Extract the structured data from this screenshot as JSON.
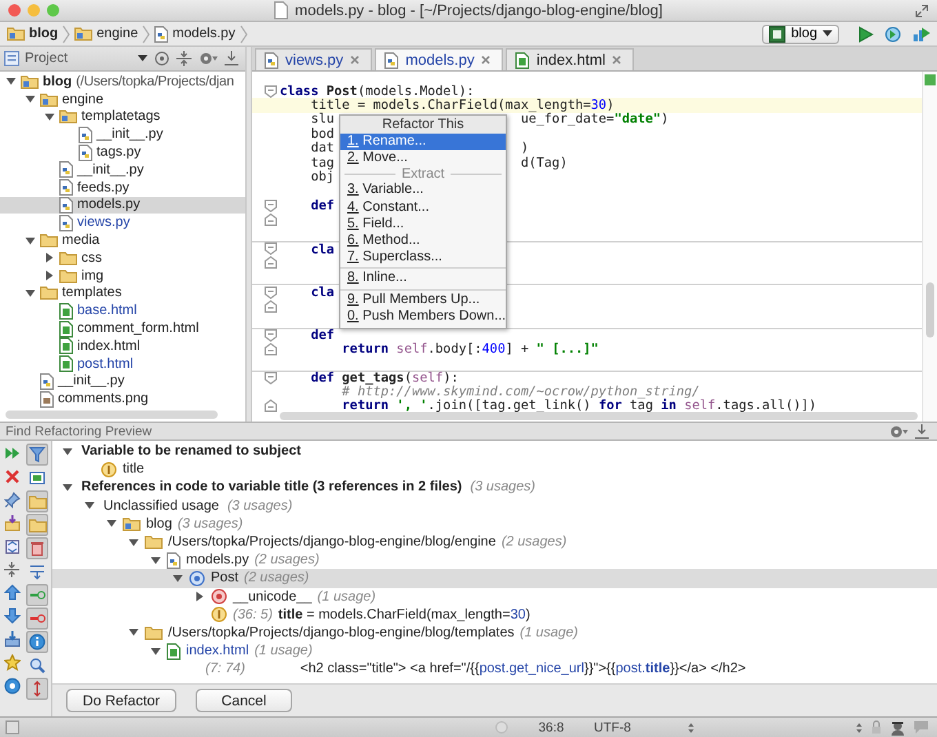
{
  "window": {
    "title": "models.py - blog - [~/Projects/django-blog-engine/blog]"
  },
  "breadcrumbs": [
    {
      "label": "blog",
      "kind": "module",
      "bold": true
    },
    {
      "label": "engine",
      "kind": "module",
      "bold": false
    },
    {
      "label": "models.py",
      "kind": "py",
      "bold": false
    }
  ],
  "run_config": {
    "label": "blog"
  },
  "project": {
    "title": "Project",
    "tree": [
      {
        "label": "blog",
        "path": "(/Users/topka/Projects/djan",
        "kind": "module",
        "expanded": true,
        "selected": false,
        "children": [
          {
            "label": "engine",
            "kind": "module",
            "expanded": true,
            "selected": false,
            "children": [
              {
                "label": "templatetags",
                "kind": "module",
                "expanded": true,
                "selected": false,
                "children": [
                  {
                    "label": "__init__.py",
                    "kind": "py",
                    "selected": false
                  },
                  {
                    "label": "tags.py",
                    "kind": "py",
                    "selected": false
                  }
                ]
              },
              {
                "label": "__init__.py",
                "kind": "py",
                "selected": false
              },
              {
                "label": "feeds.py",
                "kind": "py",
                "selected": false
              },
              {
                "label": "models.py",
                "kind": "py",
                "selected": true
              },
              {
                "label": "views.py",
                "kind": "py",
                "selected": false,
                "color": "#2545a8"
              }
            ]
          },
          {
            "label": "media",
            "kind": "folder",
            "expanded": true,
            "selected": false,
            "children": [
              {
                "label": "css",
                "kind": "folder",
                "expanded": false,
                "selected": false
              },
              {
                "label": "img",
                "kind": "folder",
                "expanded": false,
                "selected": false
              }
            ]
          },
          {
            "label": "templates",
            "kind": "folder",
            "expanded": true,
            "selected": false,
            "children": [
              {
                "label": "base.html",
                "kind": "html",
                "selected": false,
                "color": "#2545a8"
              },
              {
                "label": "comment_form.html",
                "kind": "html",
                "selected": false
              },
              {
                "label": "index.html",
                "kind": "html",
                "selected": false
              },
              {
                "label": "post.html",
                "kind": "html",
                "selected": false,
                "color": "#2545a8"
              }
            ]
          },
          {
            "label": "__init__.py",
            "kind": "py",
            "selected": false
          },
          {
            "label": "comments.png",
            "kind": "png",
            "selected": false
          }
        ]
      }
    ]
  },
  "tabs": [
    {
      "label": "views.py",
      "kind": "py",
      "selected": false,
      "color": "#2545a8"
    },
    {
      "label": "models.py",
      "kind": "py",
      "selected": true,
      "color": "#2545a8"
    },
    {
      "label": "index.html",
      "kind": "html",
      "selected": false,
      "color": "#222222"
    }
  ],
  "editor": {
    "lines": [
      {
        "kind": "code",
        "fold_start": true,
        "segs": [
          {
            "text": "class",
            "kind": "kw"
          },
          {
            "text": " Post",
            "kind": "name"
          },
          {
            "text": "(models.Model):",
            "kind": "plain"
          }
        ]
      },
      {
        "kind": "code",
        "current": true,
        "segs": [
          {
            "text": "    title = models.CharField(max_length=",
            "kind": "plain"
          },
          {
            "text": "30",
            "kind": "num"
          },
          {
            "text": ")",
            "kind": "plain"
          }
        ]
      },
      {
        "kind": "code",
        "segs": [
          {
            "text": "    slu",
            "kind": "plain"
          }
        ],
        "tail": [
          {
            "text": "ue_for_date=",
            "kind": "plain"
          },
          {
            "text": "\"date\"",
            "kind": "str"
          },
          {
            "text": ")",
            "kind": "plain"
          }
        ]
      },
      {
        "kind": "code",
        "segs": [
          {
            "text": "    bod",
            "kind": "plain"
          }
        ]
      },
      {
        "kind": "code",
        "segs": [
          {
            "text": "    dat",
            "kind": "plain"
          }
        ],
        "tail": [
          {
            "text": ")",
            "kind": "plain"
          }
        ]
      },
      {
        "kind": "code",
        "segs": [
          {
            "text": "    tag",
            "kind": "plain"
          }
        ],
        "tail": [
          {
            "text": "d(Tag)",
            "kind": "plain"
          }
        ]
      },
      {
        "kind": "code",
        "segs": [
          {
            "text": "    obj",
            "kind": "plain"
          }
        ]
      },
      {
        "kind": "blank"
      },
      {
        "kind": "code",
        "fold_start": true,
        "segs": [
          {
            "text": "    def",
            "kind": "kw"
          }
        ]
      },
      {
        "kind": "blank",
        "fold_end": true
      },
      {
        "kind": "blank"
      },
      {
        "kind": "code",
        "fold_start": true,
        "separator": true,
        "segs": [
          {
            "text": "    cla",
            "kind": "kw"
          }
        ]
      },
      {
        "kind": "blank",
        "fold_end": true
      },
      {
        "kind": "blank"
      },
      {
        "kind": "code",
        "fold_start": true,
        "separator": true,
        "segs": [
          {
            "text": "    cla",
            "kind": "kw"
          }
        ]
      },
      {
        "kind": "blank",
        "fold_end": true
      },
      {
        "kind": "blank"
      },
      {
        "kind": "code",
        "fold_start": true,
        "separator": true,
        "segs": [
          {
            "text": "    def",
            "kind": "kw"
          }
        ]
      },
      {
        "kind": "code",
        "fold_end": true,
        "segs": [
          {
            "text": "        return",
            "kind": "kw"
          },
          {
            "text": " self",
            "kind": "self"
          },
          {
            "text": ".body[:",
            "kind": "plain"
          },
          {
            "text": "400",
            "kind": "num"
          },
          {
            "text": "] + ",
            "kind": "plain"
          },
          {
            "text": "\" [...]\"",
            "kind": "str"
          }
        ]
      },
      {
        "kind": "blank"
      },
      {
        "kind": "code",
        "fold_start": true,
        "separator": true,
        "segs": [
          {
            "text": "    def",
            "kind": "kw"
          },
          {
            "text": " get_tags",
            "kind": "name"
          },
          {
            "text": "(",
            "kind": "plain"
          },
          {
            "text": "self",
            "kind": "self"
          },
          {
            "text": "):",
            "kind": "plain"
          }
        ]
      },
      {
        "kind": "code",
        "segs": [
          {
            "text": "        # http://www.skymind.com/~ocrow/python_string/",
            "kind": "comment"
          }
        ]
      },
      {
        "kind": "code",
        "fold_end": true,
        "segs": [
          {
            "text": "        return",
            "kind": "kw"
          },
          {
            "text": " ', '",
            "kind": "str"
          },
          {
            "text": ".join([tag.get_link() ",
            "kind": "plain"
          },
          {
            "text": "for",
            "kind": "kw"
          },
          {
            "text": " tag ",
            "kind": "plain"
          },
          {
            "text": "in",
            "kind": "kw"
          },
          {
            "text": " self",
            "kind": "self"
          },
          {
            "text": ".tags.all()])",
            "kind": "plain"
          }
        ]
      }
    ]
  },
  "popup": {
    "title": "Refactor This",
    "items": [
      {
        "kind": "item",
        "label": "1. Rename...",
        "selected": true
      },
      {
        "kind": "item",
        "label": "2. Move...",
        "selected": false
      },
      {
        "kind": "section",
        "label": "Extract"
      },
      {
        "kind": "item",
        "label": "3. Variable...",
        "selected": false
      },
      {
        "kind": "item",
        "label": "4. Constant...",
        "selected": false
      },
      {
        "kind": "item",
        "label": "5. Field...",
        "selected": false
      },
      {
        "kind": "item",
        "label": "6. Method...",
        "selected": false
      },
      {
        "kind": "item",
        "label": "7. Superclass...",
        "selected": false
      },
      {
        "kind": "divider"
      },
      {
        "kind": "item",
        "label": "8. Inline...",
        "selected": false
      },
      {
        "kind": "divider"
      },
      {
        "kind": "item",
        "label": "9. Pull Members Up...",
        "selected": false
      },
      {
        "kind": "item",
        "label": "0. Push Members Down...",
        "selected": false
      }
    ]
  },
  "preview": {
    "title": "Find Refactoring Preview",
    "toolbar": [
      {
        "kind": "rerun"
      },
      {
        "kind": "close"
      },
      {
        "kind": "pin"
      },
      {
        "kind": "import"
      },
      {
        "kind": "expand"
      },
      {
        "kind": "collapse"
      },
      {
        "kind": "up"
      },
      {
        "kind": "down"
      },
      {
        "kind": "export"
      },
      {
        "kind": "star"
      },
      {
        "kind": "help"
      }
    ],
    "toggles": [
      {
        "kind": "filter",
        "pressed": true
      },
      {
        "kind": "preview",
        "pressed": false
      },
      {
        "kind": "folder",
        "pressed": true
      },
      {
        "kind": "folder",
        "pressed": true
      },
      {
        "kind": "trash",
        "pressed": true
      },
      {
        "kind": "merge",
        "pressed": false
      },
      {
        "kind": "add",
        "pressed": true
      },
      {
        "kind": "remove",
        "pressed": true
      },
      {
        "kind": "info",
        "pressed": true
      },
      {
        "kind": "search",
        "pressed": false
      },
      {
        "kind": "sort",
        "pressed": true
      }
    ],
    "tree": [
      {
        "kind": "group",
        "label": "Variable to be renamed to subject",
        "bold": true,
        "expanded": true,
        "selected": false,
        "children": [
          {
            "kind": "field",
            "label": "title",
            "selected": false
          }
        ]
      },
      {
        "kind": "group",
        "label": "References in code to variable title (3 references in 2 files)",
        "bold": true,
        "usages": "(3 usages)",
        "expanded": true,
        "selected": false,
        "children": [
          {
            "kind": "group",
            "label": "Unclassified usage",
            "usages": "(3 usages)",
            "expanded": true,
            "selected": false,
            "children": [
              {
                "kind": "module",
                "label": "blog",
                "usages": "(3 usages)",
                "expanded": true,
                "selected": false,
                "children": [
                  {
                    "kind": "folder",
                    "label": "/Users/topka/Projects/django-blog-engine/blog/engine",
                    "usages": "(2 usages)",
                    "expanded": true,
                    "selected": false,
                    "children": [
                      {
                        "kind": "py",
                        "label": "models.py",
                        "usages": "(2 usages)",
                        "expanded": true,
                        "selected": false,
                        "children": [
                          {
                            "kind": "class",
                            "label": "Post",
                            "usages": "(2 usages)",
                            "expanded": true,
                            "selected": true,
                            "children": [
                              {
                                "kind": "method",
                                "label": "__unicode__",
                                "usages": "(1 usage)",
                                "expanded": false,
                                "selected": false
                              },
                              {
                                "kind": "field",
                                "location": "(36: 5)",
                                "selected": false,
                                "code": [
                                  {
                                    "text": "**title** = models.CharField(max_length=",
                                    "kind": "plain"
                                  },
                                  {
                                    "text": "30",
                                    "kind": "num"
                                  },
                                  {
                                    "text": ")",
                                    "kind": "plain"
                                  }
                                ]
                              }
                            ]
                          }
                        ]
                      }
                    ]
                  },
                  {
                    "kind": "folder",
                    "label": "/Users/topka/Projects/django-blog-engine/blog/templates",
                    "usages": "(1 usage)",
                    "expanded": true,
                    "selected": false,
                    "children": [
                      {
                        "kind": "html",
                        "label": "index.html",
                        "usages": "(1 usage)",
                        "expanded": true,
                        "selected": false,
                        "color": "#2545a8",
                        "children": [
                          {
                            "kind": "usage",
                            "location": "(7: 74)",
                            "selected": false,
                            "code": [
                              {
                                "text": "<h2 class=\"title\"> <a href=\"/{{ ",
                                "kind": "plain"
                              },
                              {
                                "text": "post.get_nice_url",
                                "kind": "ref"
                              },
                              {
                                "text": " }}\">{{ ",
                                "kind": "plain"
                              },
                              {
                                "text": "post.**title**",
                                "kind": "ref"
                              },
                              {
                                "text": " }}</a> </h2>",
                                "kind": "plain"
                              }
                            ]
                          }
                        ]
                      }
                    ]
                  }
                ]
              }
            ]
          }
        ]
      }
    ],
    "buttons": [
      "Do Refactor",
      "Cancel"
    ]
  },
  "status_bar": {
    "position": "36:8",
    "encoding": "UTF-8"
  }
}
